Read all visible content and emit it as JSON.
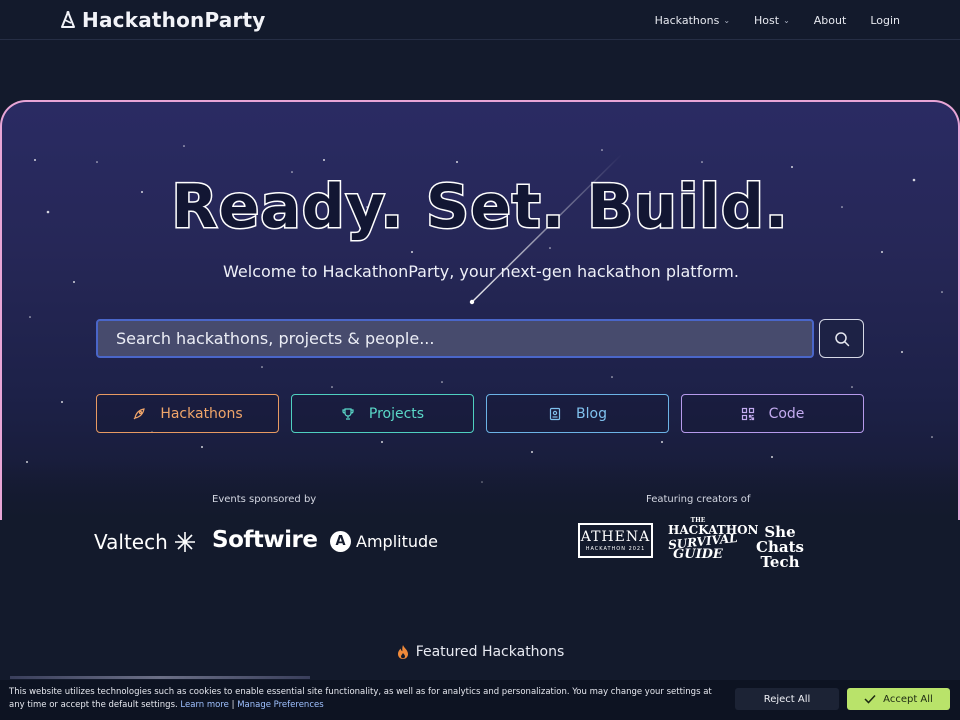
{
  "nav": {
    "brand": "HackathonParty",
    "links": [
      {
        "label": "Hackathons",
        "has_dropdown": true
      },
      {
        "label": "Host",
        "has_dropdown": true
      },
      {
        "label": "About",
        "has_dropdown": false
      },
      {
        "label": "Login",
        "has_dropdown": false
      }
    ]
  },
  "hero": {
    "headline": "Ready. Set. Build.",
    "subtitle": "Welcome to HackathonParty, your next-gen hackathon platform.",
    "search": {
      "placeholder": "Search hackathons, projects & people...",
      "value": "",
      "button_icon": "search-icon"
    },
    "categories": [
      {
        "label": "Hackathons",
        "icon": "rocket-icon",
        "color": "#e79a62"
      },
      {
        "label": "Projects",
        "icon": "trophy-icon",
        "color": "#4fd0c0"
      },
      {
        "label": "Blog",
        "icon": "book-icon",
        "color": "#6cb3e6"
      },
      {
        "label": "Code",
        "icon": "qr-code-icon",
        "color": "#b69aeb"
      }
    ]
  },
  "sponsors": {
    "label": "Events sponsored by",
    "items": [
      "Valtech",
      "Softwire",
      "Amplitude"
    ]
  },
  "creators": {
    "label": "Featuring creators of",
    "athena": {
      "title": "ATHENA",
      "subtitle": "HACKATHON 2021"
    },
    "survival_guide": {
      "line1": "THE",
      "line2": "HACKATHON",
      "line3": "SURVIVAL",
      "line4": "GUIDE"
    },
    "she_chats_tech": {
      "line1": "She Chats",
      "line2": "Tech"
    }
  },
  "featured": {
    "title": "Featured Hackathons",
    "icon": "fire-icon"
  },
  "cookie": {
    "text": "This website utilizes technologies such as cookies to enable essential site functionality, as well as for analytics and personalization. You may change your settings at any time or accept the default settings.",
    "learn_more": "Learn more",
    "separator": "|",
    "manage": "Manage Preferences",
    "reject": "Reject All",
    "accept": "Accept All"
  },
  "colors": {
    "background": "#131a2c",
    "hero_border": "#e8a5d6",
    "accept_button": "#b9e36a"
  }
}
